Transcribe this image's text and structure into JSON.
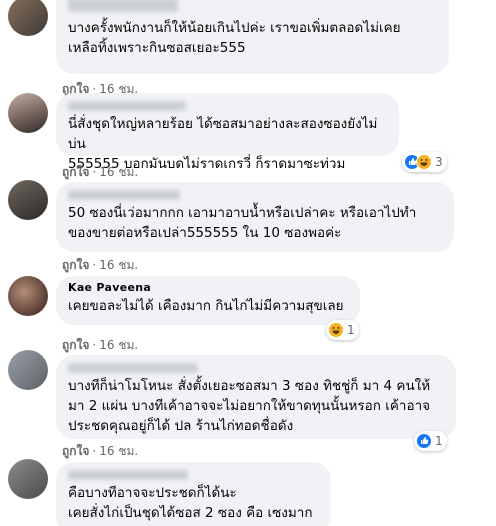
{
  "comments": [
    {
      "author": "",
      "text": "บางครั้งพนักงานก็ให้น้อยเกินไปค่ะ เราขอเพิ่มตลอดไม่เคย\nเหลือทิ้งเพราะกินซอสเยอะ555",
      "like_label": "ถูกใจ",
      "time": "16 ชม."
    },
    {
      "author": "",
      "text": "นี่สั่งชุดใหญ่หลายร้อย ได้ซอสมาอย่างละสองซองยังไม่บ่น\n555555 บอกมันบดไม่ราดเกรวี่ ก็ราดมาซะท่วม",
      "like_label": "ถูกใจ",
      "time": "16 ชม.",
      "reaction_count": "3"
    },
    {
      "author": "",
      "text": "50 ซองนี่เว่อมากกก เอามาอาบน้ำหรือเปล่าคะ หรือเอาไปทำ\nของขายต่อหรือเปล่า555555 ใน 10 ซองพอค่ะ",
      "like_label": "ถูกใจ",
      "time": "16 ชม."
    },
    {
      "author": "Kae Paveena",
      "text": "เคยขอละไม่ได้ เคืองมาก กินไก่ไม่มีความสุขเลย",
      "like_label": "ถูกใจ",
      "time": "16 ชม.",
      "reaction_count": "1"
    },
    {
      "author": "",
      "text": "บางทีก็น่าโมโหนะ สั่งตั้งเยอะซอสมา 3 ซอง ทิชชู่ก็ มา 4 คนให้\nมา 2 แผ่น บางทีเค้าอาจจะไม่อยากให้ขาดทุนนั้นหรอก เค้าอาจ\nประชดคุณอยู่ก็ได้ ปล ร้านไก่ทอดชื่อดัง",
      "like_label": "ถูกใจ",
      "time": "16 ชม.",
      "reaction_count": "1"
    },
    {
      "author": "",
      "text": "คือบางทีอาจจะประชดก็ได้นะ\nเคยสั่งไก่เป็นชุดได้ซอส 2 ซอง คือ เซงมาก"
    }
  ],
  "colors": {
    "bubble": "#f0f2f5",
    "meta": "#65676b",
    "like_blue": "#1877f2",
    "haha_yellow": "#f7b125"
  }
}
